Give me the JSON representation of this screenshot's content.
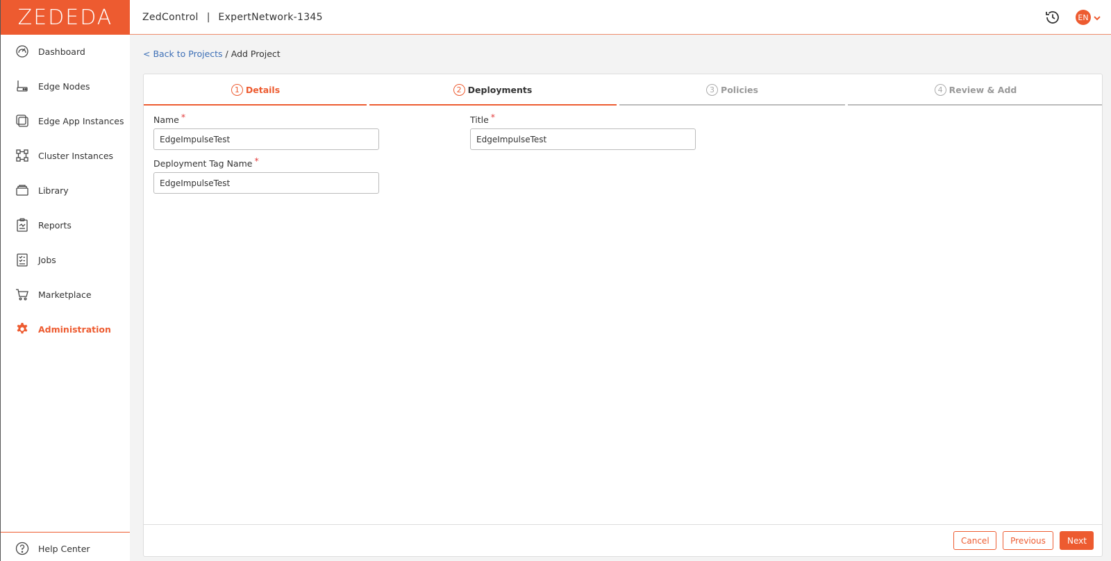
{
  "app": {
    "logo_text": "ZEDEDA",
    "product": "ZedControl",
    "separator": "|",
    "enterprise": "ExpertNetwork-1345",
    "language": "EN"
  },
  "sidebar": {
    "items": [
      {
        "label": "Dashboard",
        "icon": "dashboard-icon"
      },
      {
        "label": "Edge Nodes",
        "icon": "edge-node-icon"
      },
      {
        "label": "Edge App Instances",
        "icon": "app-instances-icon"
      },
      {
        "label": "Cluster Instances",
        "icon": "cluster-icon"
      },
      {
        "label": "Library",
        "icon": "library-icon"
      },
      {
        "label": "Reports",
        "icon": "reports-icon"
      },
      {
        "label": "Jobs",
        "icon": "jobs-icon"
      },
      {
        "label": "Marketplace",
        "icon": "cart-icon"
      },
      {
        "label": "Administration",
        "icon": "gear-icon",
        "active": true
      }
    ],
    "help": "Help Center"
  },
  "breadcrumb": {
    "back": "< Back to Projects",
    "sep": " / ",
    "current": "Add Project"
  },
  "steps": [
    {
      "num": "1",
      "label": "Details",
      "state": "done"
    },
    {
      "num": "2",
      "label": "Deployments",
      "state": "current"
    },
    {
      "num": "3",
      "label": "Policies",
      "state": "todo"
    },
    {
      "num": "4",
      "label": "Review & Add",
      "state": "todo"
    }
  ],
  "form": {
    "name": {
      "label": "Name",
      "value": "EdgeImpulseTest"
    },
    "title": {
      "label": "Title",
      "value": "EdgeImpulseTest"
    },
    "tag": {
      "label": "Deployment Tag Name",
      "value": "EdgeImpulseTest"
    },
    "required_mark": "*"
  },
  "footer": {
    "cancel": "Cancel",
    "previous": "Previous",
    "next": "Next"
  },
  "colors": {
    "accent": "#ed5b30",
    "link": "#3d6fb6"
  }
}
